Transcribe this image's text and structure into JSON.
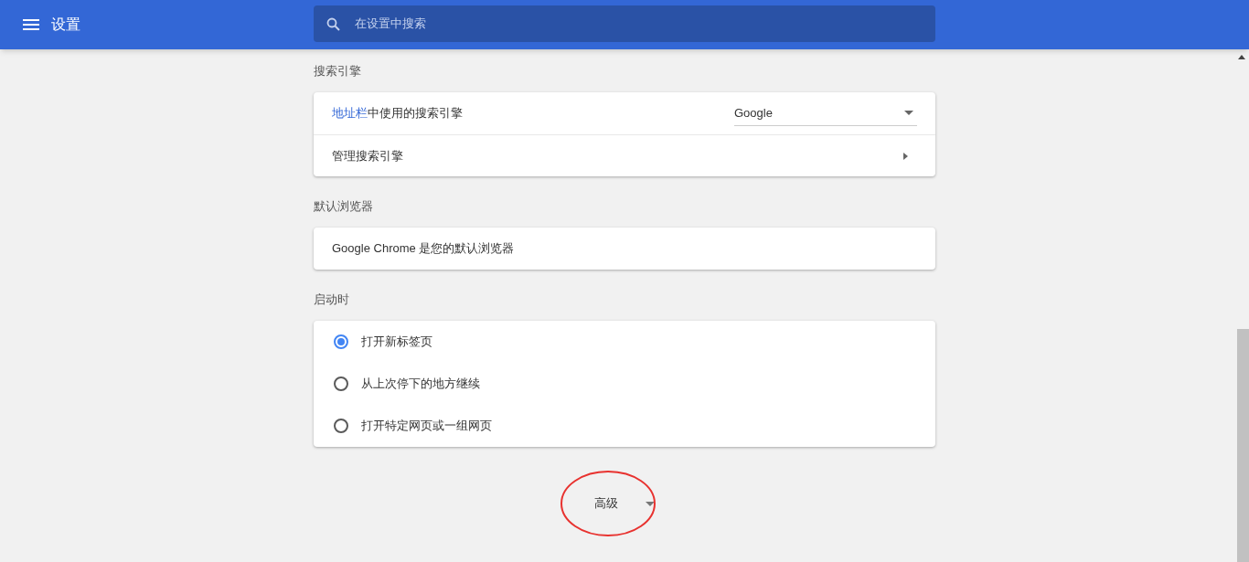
{
  "header": {
    "title": "设置",
    "search_placeholder": "在设置中搜索"
  },
  "sections": [
    {
      "title": "搜索引擎",
      "rows": [
        {
          "kind": "select",
          "link": "地址栏",
          "label": "中使用的搜索引擎",
          "value": "Google"
        },
        {
          "kind": "link",
          "label": "管理搜索引擎"
        }
      ]
    },
    {
      "title": "默认浏览器",
      "rows": [
        {
          "kind": "text",
          "label": "Google Chrome 是您的默认浏览器"
        }
      ]
    },
    {
      "title": "启动时",
      "rows": [
        {
          "kind": "radio",
          "label": "打开新标签页",
          "selected": true
        },
        {
          "kind": "radio",
          "label": "从上次停下的地方继续",
          "selected": false
        },
        {
          "kind": "radio",
          "label": "打开特定网页或一组网页",
          "selected": false
        }
      ]
    }
  ],
  "advanced": {
    "label": "高级",
    "circled": true
  }
}
